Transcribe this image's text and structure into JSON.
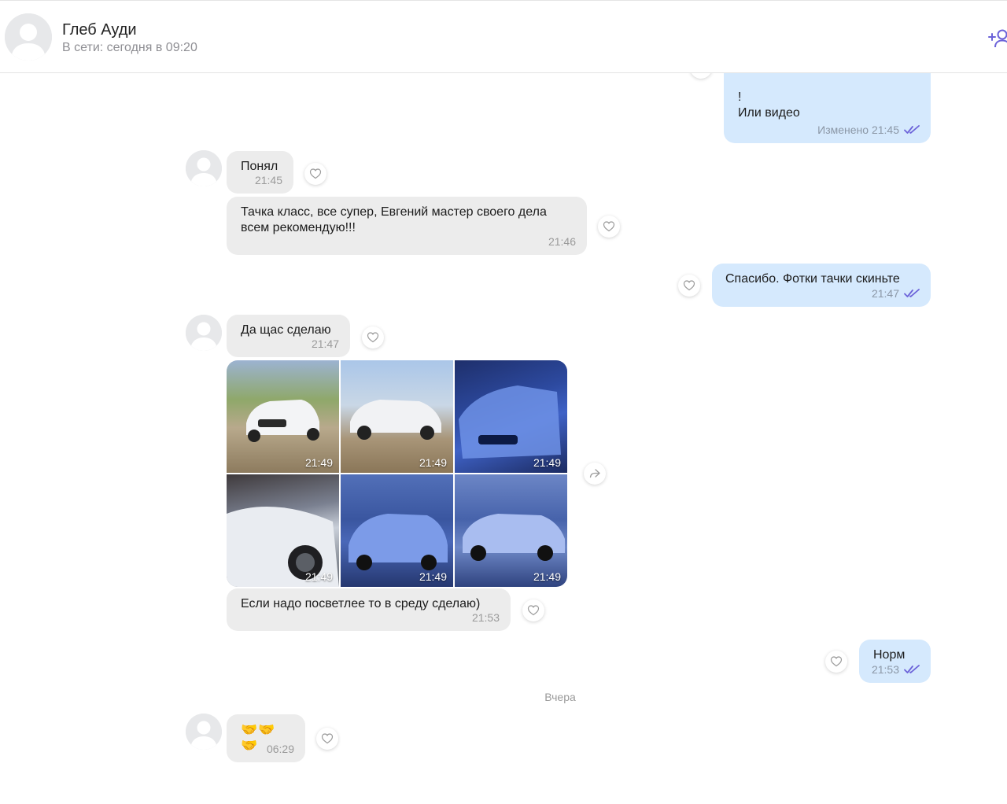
{
  "header": {
    "name": "Глеб Ауди",
    "status": "В сети: сегодня в 09:20"
  },
  "messages": [
    {
      "dir": "out",
      "lines": [
        "!",
        "Или видео"
      ],
      "time": "Изменено 21:45",
      "read": true
    },
    {
      "dir": "in",
      "text": "Понял",
      "time": "21:45"
    },
    {
      "dir": "in",
      "lines": [
        "Тачка класс, все супер, Евгений мастер своего дела",
        "всем рекомендую!!!"
      ],
      "time": "21:46"
    },
    {
      "dir": "out",
      "text": "Спасибо. Фотки тачки скиньте",
      "time": "21:47",
      "read": true
    },
    {
      "dir": "in",
      "text": "Да щас сделаю",
      "time": "21:47"
    },
    {
      "dir": "in",
      "type": "photos",
      "photos": [
        "21:49",
        "21:49",
        "21:49",
        "21:49",
        "21:49",
        "21:49"
      ]
    },
    {
      "dir": "in",
      "text": "Если надо посветлее то в среду сделаю)",
      "time": "21:53"
    },
    {
      "dir": "out",
      "text": "Норм",
      "time": "21:53",
      "read": true
    },
    {
      "dir": "in",
      "text": "🤝🤝🤝",
      "time": "06:29"
    }
  ],
  "date_separator": "Вчера",
  "colors": {
    "incoming_bubble": "#ececec",
    "outgoing_bubble": "#d5e9fd",
    "accent": "#6c63d9"
  },
  "icons": {
    "reaction": "heart-icon",
    "read_status": "double-check-icon",
    "share": "share-icon",
    "add_member": "add-user-icon"
  }
}
